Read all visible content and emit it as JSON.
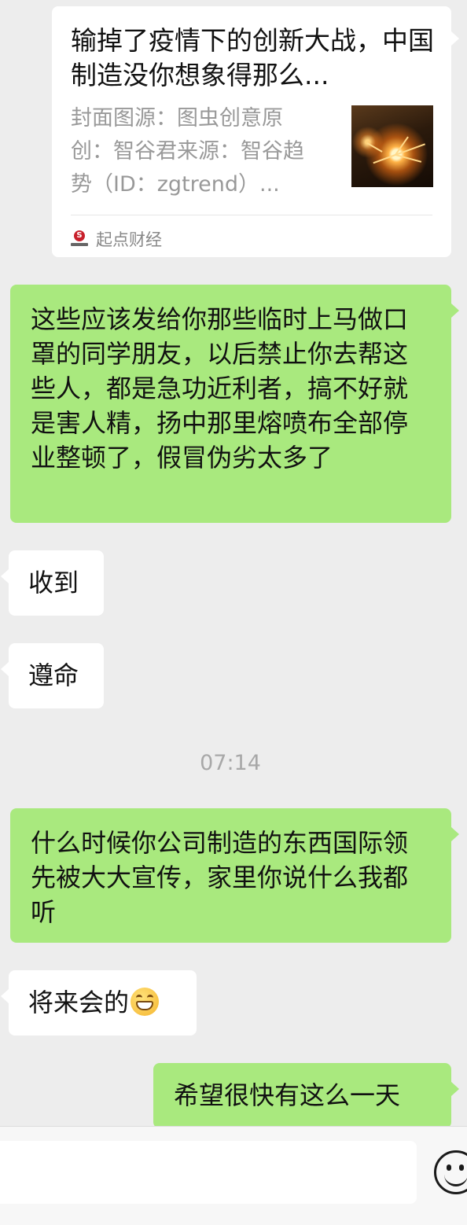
{
  "link_card": {
    "title": "输掉了疫情下的创新大战，中国制造没你想象得那么...",
    "description": "封面图源：图虫创意原创：智谷君来源：智谷趋势（ID：zgtrend）...",
    "source": "起点财经"
  },
  "messages": [
    {
      "side": "right",
      "text": "这些应该发给你那些临时上马做口罩的同学朋友，以后禁止你去帮这些人，都是急功近利者，搞不好就是害人精，扬中那里熔喷布全部停业整顿了，假冒伪劣太多了"
    },
    {
      "side": "left",
      "text": "收到"
    },
    {
      "side": "left",
      "text": "遵命"
    },
    {
      "side": "right",
      "text": "什么时候你公司制造的东西国际领先被大大宣传，家里你说什么我都听"
    },
    {
      "side": "left",
      "text": "将来会的",
      "emoji": "grinning-face-emoji"
    },
    {
      "side": "right",
      "text": "希望很快有这么一天"
    }
  ],
  "timestamp": "07:14",
  "input_bar": {
    "placeholder": "",
    "emoji_button": "smiley-face-icon"
  }
}
